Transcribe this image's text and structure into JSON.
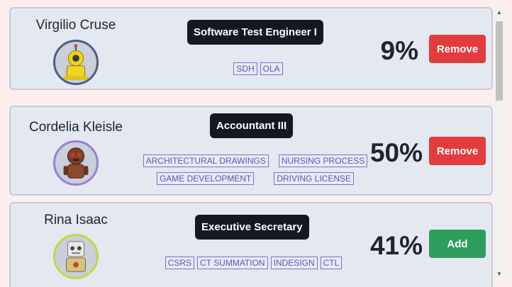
{
  "candidates": [
    {
      "name": "Virgilio Cruse",
      "avatar_icon": "yellow-robot-avatar-icon",
      "job_title": "Software Test Engineer I",
      "skills": [
        "SDH",
        "OLA"
      ],
      "match_percent": "9%",
      "action_label": "Remove",
      "action_color": "#e23c3e"
    },
    {
      "name": "Cordelia Kleisle",
      "avatar_icon": "brown-robot-avatar-icon",
      "job_title": "Accountant III",
      "skills": [
        "ARCHITECTURAL DRAWINGS",
        "NURSING PROCESS",
        "GAME DEVELOPMENT",
        "DRIVING LICENSE"
      ],
      "match_percent": "50%",
      "action_label": "Remove",
      "action_color": "#e23c3e"
    },
    {
      "name": "Rina Isaac",
      "avatar_icon": "gray-robot-avatar-icon",
      "job_title": "Executive Secretary",
      "skills": [
        "CSRS",
        "CT SUMMATION",
        "INDESIGN",
        "CTL"
      ],
      "match_percent": "41%",
      "action_label": "Add",
      "action_color": "#2e9e5e"
    }
  ],
  "colors": {
    "background": "#fdeeee",
    "card": "#e4e8f1",
    "remove": "#e23c3e",
    "add": "#2e9e5e",
    "tag": "#5e57b3"
  }
}
